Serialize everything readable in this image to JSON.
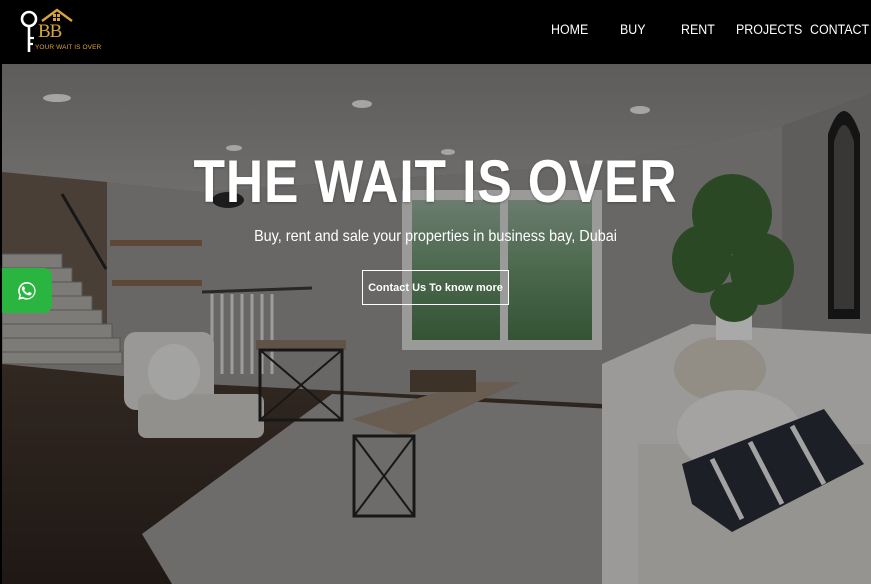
{
  "brand": {
    "logo_initials": "BB",
    "tagline": "YOUR WAIT IS OVER",
    "accent_color": "#d9a53a"
  },
  "nav": {
    "items": [
      {
        "label": "HOME"
      },
      {
        "label": "BUY"
      },
      {
        "label": "RENT"
      },
      {
        "label": "PROJECTS"
      },
      {
        "label": "CONTACT"
      }
    ]
  },
  "hero": {
    "title": "THE WAIT IS OVER",
    "subtitle": "Buy, rent and sale your properties in business bay, Dubai",
    "cta_label": "Contact Us To know more"
  },
  "floating": {
    "whatsapp_icon": "whatsapp-icon",
    "whatsapp_color": "#2ab540"
  }
}
